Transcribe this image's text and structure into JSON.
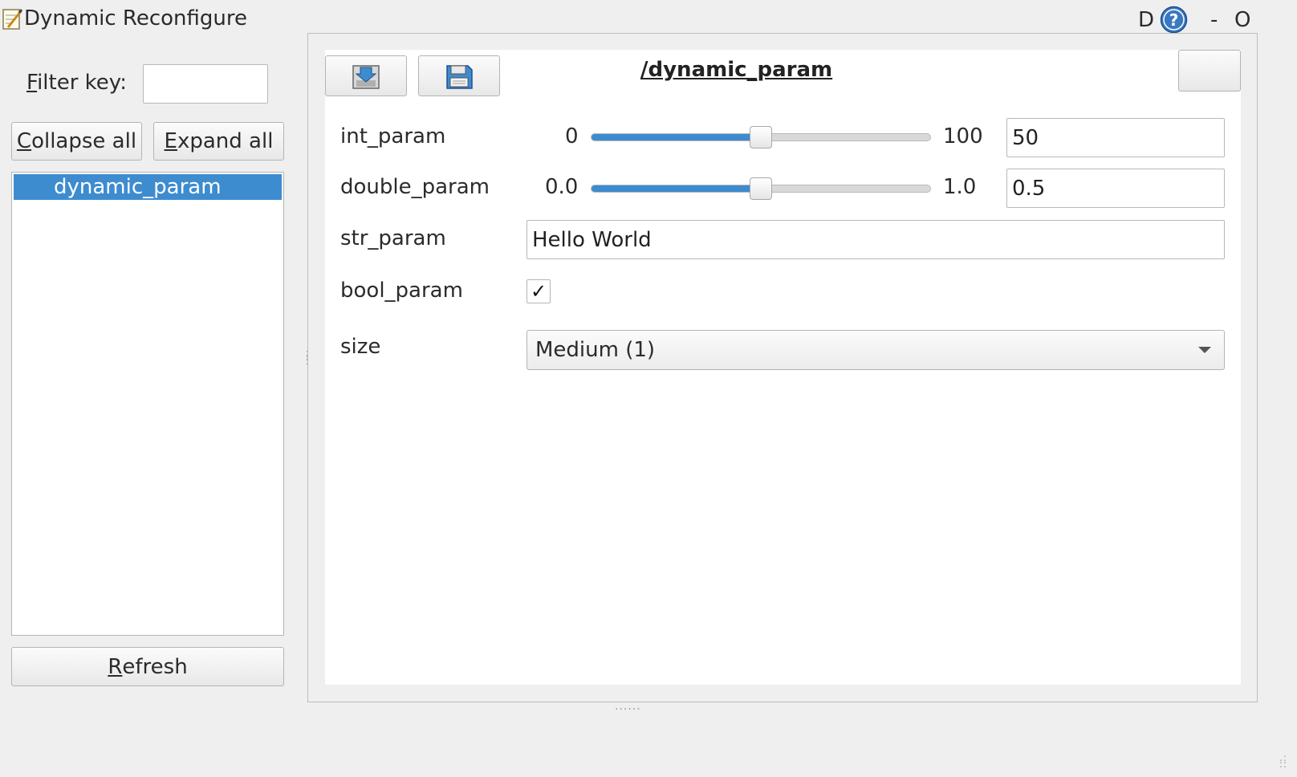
{
  "window": {
    "title": "Dynamic Reconfigure",
    "icon": "notepad-pencil-icon",
    "controls": {
      "d_label": "D",
      "help_icon": "help-question-icon",
      "minimize_label": "-",
      "close_label": "O"
    }
  },
  "left_panel": {
    "filter_label_mnemonic": "F",
    "filter_label_rest": "ilter key:",
    "filter_value": "",
    "collapse_mnemonic": "C",
    "collapse_rest": "ollapse all",
    "expand_mnemonic": "E",
    "expand_rest": "xpand all",
    "tree_items": [
      "dynamic_param"
    ],
    "selected_item": "dynamic_param",
    "refresh_mnemonic": "R",
    "refresh_rest": "efresh"
  },
  "right_panel": {
    "node_name": "/dynamic_param",
    "load_icon": "load-config-icon",
    "save_icon": "save-floppy-icon",
    "params": {
      "int_param": {
        "label": "int_param",
        "min": "0",
        "max": "100",
        "value": "50",
        "fraction": 0.5
      },
      "double_param": {
        "label": "double_param",
        "min": "0.0",
        "max": "1.0",
        "value": "0.5",
        "fraction": 0.5
      },
      "str_param": {
        "label": "str_param",
        "value": "Hello World"
      },
      "bool_param": {
        "label": "bool_param",
        "checked": true,
        "check_glyph": "✓"
      },
      "size": {
        "label": "size",
        "selected": "Medium (1)"
      }
    }
  },
  "colors": {
    "accent": "#3d8cd0",
    "background": "#efefef",
    "panel": "#ffffff"
  }
}
